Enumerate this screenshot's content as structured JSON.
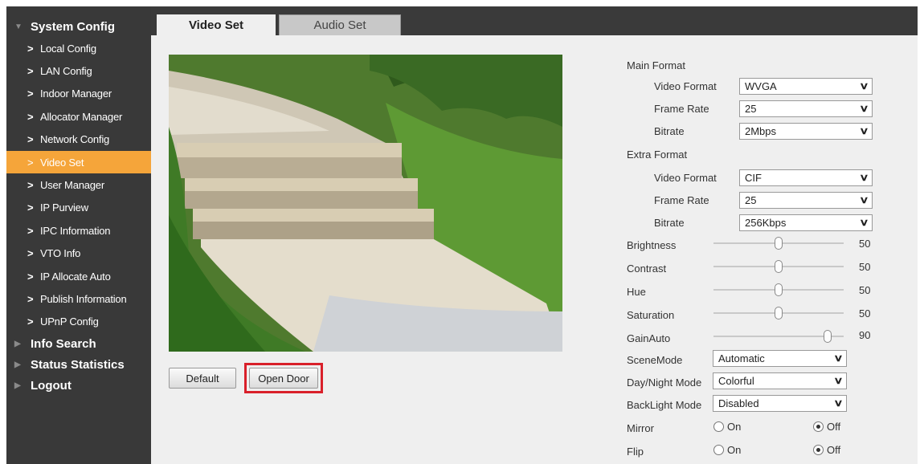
{
  "sidebar": {
    "sections": [
      {
        "title": "System Config"
      },
      {
        "title": "Info Search"
      },
      {
        "title": "Status Statistics"
      },
      {
        "title": "Logout"
      }
    ],
    "items": [
      {
        "label": "Local Config"
      },
      {
        "label": "LAN Config"
      },
      {
        "label": "Indoor Manager"
      },
      {
        "label": "Allocator Manager"
      },
      {
        "label": "Network Config"
      },
      {
        "label": "Video Set",
        "active": true
      },
      {
        "label": "User Manager"
      },
      {
        "label": "IP Purview"
      },
      {
        "label": "IPC Information"
      },
      {
        "label": "VTO Info"
      },
      {
        "label": "IP Allocate Auto"
      },
      {
        "label": "Publish Information"
      },
      {
        "label": "UPnP Config"
      }
    ]
  },
  "tabs": [
    {
      "label": "Video Set",
      "active": true
    },
    {
      "label": "Audio Set"
    }
  ],
  "buttons": {
    "default": "Default",
    "open_door": "Open Door"
  },
  "settings": {
    "main_format": "Main Format",
    "extra_format": "Extra Format",
    "main": {
      "video_format_label": "Video Format",
      "video_format": "WVGA",
      "frame_rate_label": "Frame Rate",
      "frame_rate": "25",
      "bitrate_label": "Bitrate",
      "bitrate": "2Mbps"
    },
    "extra": {
      "video_format_label": "Video Format",
      "video_format": "CIF",
      "frame_rate_label": "Frame Rate",
      "frame_rate": "25",
      "bitrate_label": "Bitrate",
      "bitrate": "256Kbps"
    },
    "sliders": [
      {
        "label": "Brightness",
        "value": "50",
        "level": 50
      },
      {
        "label": "Contrast",
        "value": "50",
        "level": 50
      },
      {
        "label": "Hue",
        "value": "50",
        "level": 50
      },
      {
        "label": "Saturation",
        "value": "50",
        "level": 50
      },
      {
        "label": "GainAuto",
        "value": "90",
        "level": 90
      }
    ],
    "scene_mode_label": "SceneMode",
    "scene_mode": "Automatic",
    "day_night_label": "Day/Night Mode",
    "day_night": "Colorful",
    "backlight_label": "BackLight Mode",
    "backlight": "Disabled",
    "mirror_label": "Mirror",
    "mirror_on": "On",
    "mirror_off": "Off",
    "flip_label": "Flip",
    "flip_on": "On",
    "flip_off": "Off"
  },
  "colors": {
    "sidebar_bg": "#393939",
    "active_item": "#f5a53a",
    "highlight": "#d9202a"
  },
  "icons": {
    "chevron": "chevron-right-icon",
    "select": "chevron-down-icon"
  }
}
